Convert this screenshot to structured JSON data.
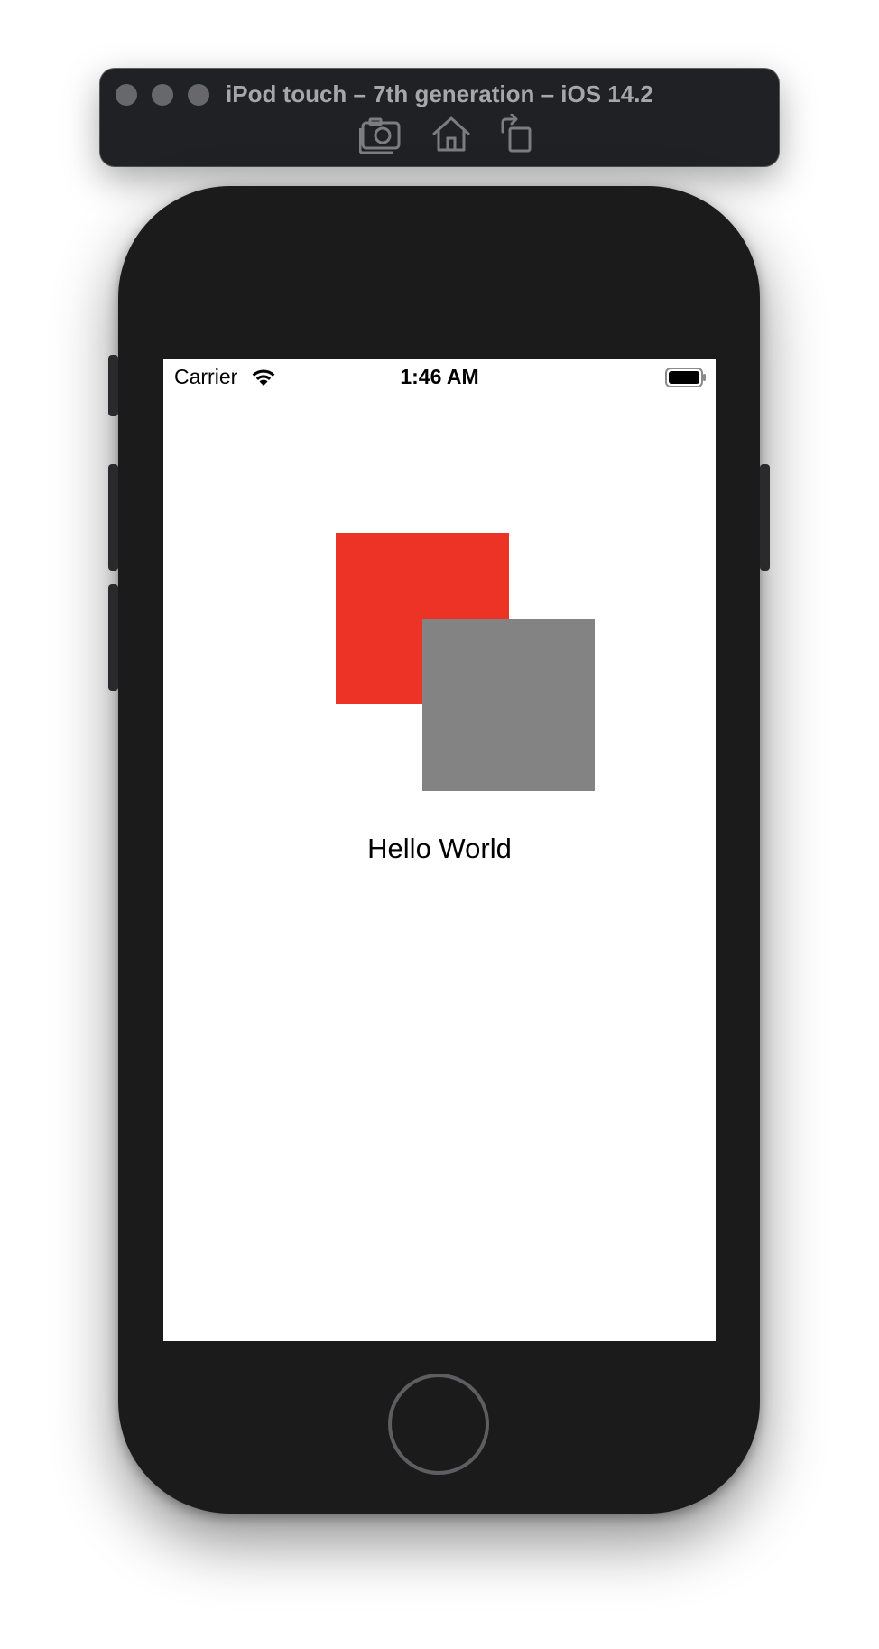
{
  "simulator": {
    "title": "iPod touch – 7th generation – iOS 14.2",
    "toolbar": [
      {
        "name": "screenshot-icon"
      },
      {
        "name": "home-icon"
      },
      {
        "name": "rotate-icon"
      }
    ]
  },
  "status_bar": {
    "carrier": "Carrier",
    "time": "1:46 AM",
    "wifi": "wifi-icon",
    "battery": "battery-icon"
  },
  "content": {
    "label": "Hello World",
    "red_square_color": "#ec3325",
    "gray_square_color": "#838383"
  }
}
